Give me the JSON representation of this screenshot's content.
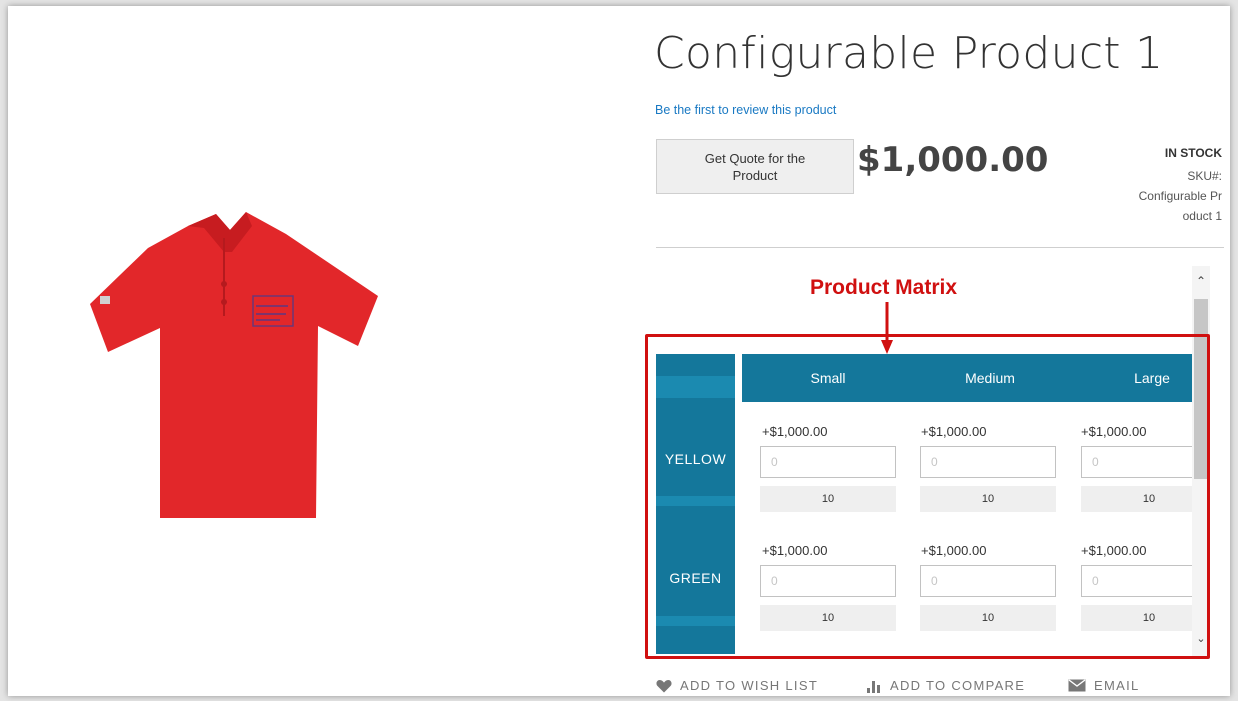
{
  "product": {
    "title": "Configurable Product 1",
    "review_link": "Be the first to review this product",
    "quote_button": "Get Quote for the Product",
    "price": "$1,000.00",
    "stock_status": "IN STOCK",
    "sku_label": "SKU#:",
    "sku_value_lines": [
      "Configurable Pr",
      "oduct 1"
    ]
  },
  "annotation": {
    "label": "Product Matrix",
    "color": "#d01010"
  },
  "matrix": {
    "header_color": "#14779b",
    "columns": [
      "Small",
      "Medium",
      "Large"
    ],
    "rows": [
      {
        "label": "YELLOW",
        "cells": [
          {
            "price": "+$1,000.00",
            "qty_placeholder": "0",
            "stock": "10"
          },
          {
            "price": "+$1,000.00",
            "qty_placeholder": "0",
            "stock": "10"
          },
          {
            "price": "+$1,000.00",
            "qty_placeholder": "0",
            "stock": "10"
          }
        ]
      },
      {
        "label": "GREEN",
        "cells": [
          {
            "price": "+$1,000.00",
            "qty_placeholder": "0",
            "stock": "10"
          },
          {
            "price": "+$1,000.00",
            "qty_placeholder": "0",
            "stock": "10"
          },
          {
            "price": "+$1,000.00",
            "qty_placeholder": "0",
            "stock": "10"
          }
        ]
      }
    ]
  },
  "actions": {
    "wishlist": {
      "label": "ADD TO WISH LIST",
      "icon": "heart-icon"
    },
    "compare": {
      "label": "ADD TO COMPARE",
      "icon": "bar-chart-icon"
    },
    "email": {
      "label": "EMAIL",
      "icon": "envelope-icon"
    }
  },
  "image": {
    "shirt_color": "#e2272a"
  }
}
